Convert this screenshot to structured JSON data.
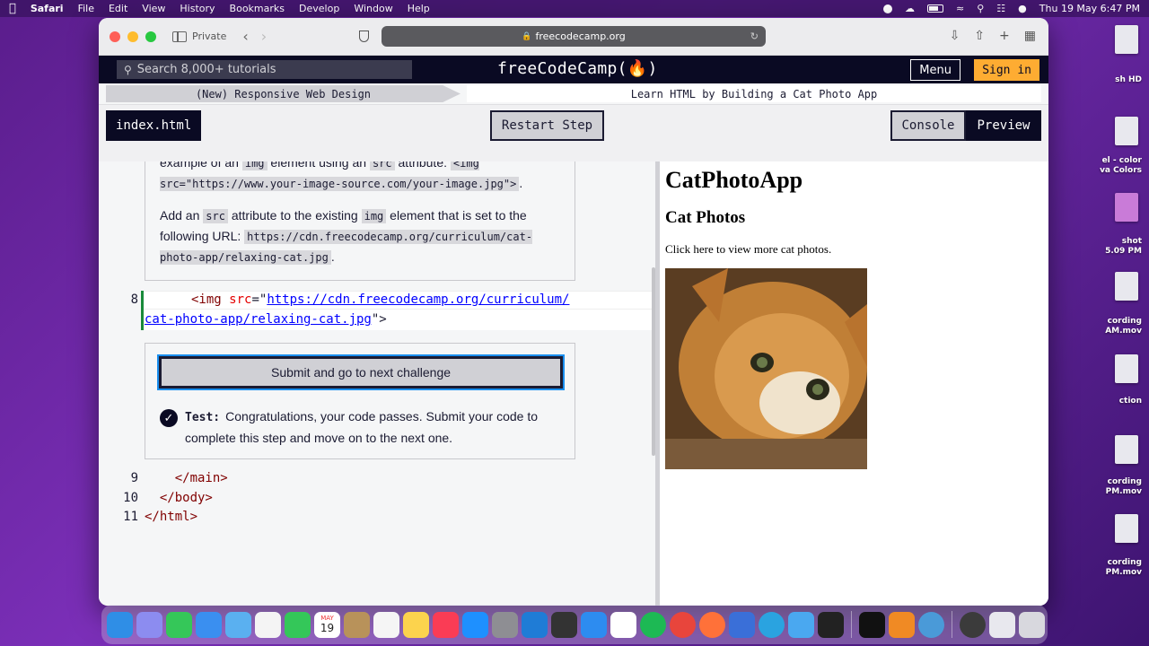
{
  "menubar": {
    "app": "Safari",
    "items": [
      "File",
      "Edit",
      "View",
      "History",
      "Bookmarks",
      "Develop",
      "Window",
      "Help"
    ],
    "datetime": "Thu 19 May  6:47 PM"
  },
  "desktop": {
    "labels": [
      "sh HD",
      "el - color\nva Colors",
      "shot\n5.09 PM",
      "cording\nAM.mov",
      "ction",
      "cording\nPM.mov",
      "cording\nPM.mov"
    ]
  },
  "browser": {
    "private_label": "Private",
    "url": "freecodecamp.org"
  },
  "fcc_nav": {
    "search_placeholder": "Search 8,000+ tutorials",
    "logo": "freeCodeCamp(🔥)",
    "menu_label": "Menu",
    "signin_label": "Sign in"
  },
  "breadcrumb": {
    "superblock": "(New) Responsive Web Design",
    "block": "Learn HTML by Building a Cat Photo App"
  },
  "editor_toolbar": {
    "file_tab": "index.html",
    "restart_label": "Restart Step",
    "console_label": "Console",
    "preview_label": "Preview"
  },
  "description": {
    "p1_text1": "example of an ",
    "p1_code1": "img",
    "p1_text2": " element using an ",
    "p1_code2": "src",
    "p1_text3": " attribute: ",
    "p1_code3": "<img src=\"https://www.your-image-source.com/your-image.jpg\">",
    "p1_text4": ".",
    "p2_text1": "Add an ",
    "p2_code1": "src",
    "p2_text2": " attribute to the existing ",
    "p2_code2": "img",
    "p2_text3": " element that is set to the following URL: ",
    "p2_code3": "https://cdn.freecodecamp.org/curriculum/cat-photo-app/relaxing-cat.jpg",
    "p2_text4": "."
  },
  "code": {
    "line8_no": "8",
    "line8_open": "<img ",
    "line8_attr": "src",
    "line8_eq": "=\"",
    "line8_url_a": "https://cdn.freecodecamp.org/curriculum/",
    "line8_url_b": "cat-photo-app/relaxing-cat.jpg",
    "line8_close": "\">",
    "lines_after": [
      {
        "no": "9",
        "text": "    </main>"
      },
      {
        "no": "10",
        "text": "  </body>"
      },
      {
        "no": "11",
        "text": "</html>"
      }
    ]
  },
  "test": {
    "submit_label": "Submit and go to next challenge",
    "label": "Test:",
    "message": "Congratulations, your code passes. Submit your code to complete this step and move on to the next one."
  },
  "preview": {
    "h1": "CatPhotoApp",
    "h2": "Cat Photos",
    "p": "Click here to view more cat photos."
  },
  "dock": {
    "calendar_month": "MAY",
    "calendar_day": "19"
  }
}
